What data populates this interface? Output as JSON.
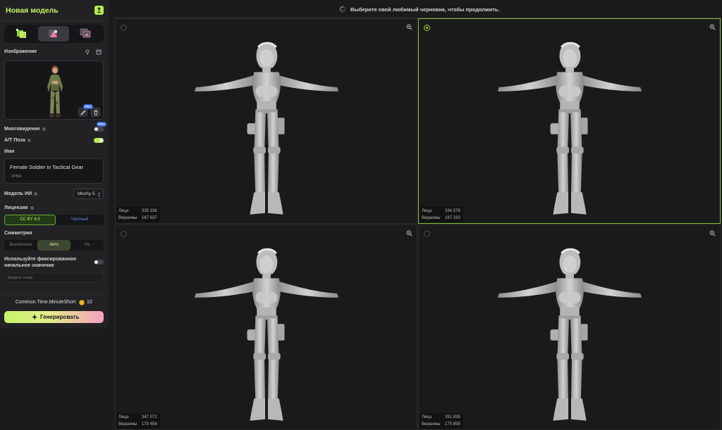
{
  "panel": {
    "title": "Новая модель",
    "image_label": "Изображение",
    "multiview_label": "Многовидение",
    "multiview_on": false,
    "pose_label": "A/T Поза",
    "pose_on": true,
    "name_label": "Имя",
    "name_value": "Female Soldier in Tactical Gear",
    "name_tag": "#PBR",
    "ai_model_label": "Модель ИИ",
    "ai_model_value": "Meshy 5",
    "license_label": "Лицензия",
    "license_options": [
      "CC BY 4.0",
      "Частный"
    ],
    "license_selected": "CC BY 4.0",
    "symmetry_label": "Симметрия",
    "symmetry_options": [
      "Выключено",
      "Авто",
      "На"
    ],
    "symmetry_selected": "Авто",
    "seed_label": "Используйте фиксированное начальное значение",
    "seed_on": false,
    "seed_placeholder": "Введите номер",
    "pro_badge": "PRO",
    "time_text": "Common.Time.MinuteShort",
    "cost": "10",
    "generate_label": "Генерировать"
  },
  "topbar": {
    "message": "Выберите свой любимый черновик, чтобы продолжить."
  },
  "drafts": [
    {
      "faces_label": "Лица",
      "faces": "335 338",
      "verts_label": "Вершины",
      "verts": "167 637",
      "selected": false
    },
    {
      "faces_label": "Лица",
      "faces": "334 578",
      "verts_label": "Вершины",
      "verts": "167 233",
      "selected": true
    },
    {
      "faces_label": "Лица",
      "faces": "347 072",
      "verts_label": "Вершины",
      "verts": "173 456",
      "selected": false
    },
    {
      "faces_label": "Лица",
      "faces": "351 838",
      "verts_label": "Вершины",
      "verts": "175 859",
      "selected": false
    }
  ],
  "colors": {
    "accent": "#c6f464",
    "selected_border": "#8cbf3e",
    "panel": "#222225",
    "background": "#1b1b1d",
    "pro_badge": "#3b68e8"
  },
  "icons": [
    "export-icon",
    "text-to-3d-icon",
    "image-to-3d-icon",
    "multi-image-icon",
    "pin-icon",
    "copy-icon",
    "edit-icon",
    "trash-icon",
    "info-icon",
    "chevron-icon",
    "sparkle-icon",
    "loader-icon",
    "zoom-in-icon",
    "coin-icon"
  ]
}
